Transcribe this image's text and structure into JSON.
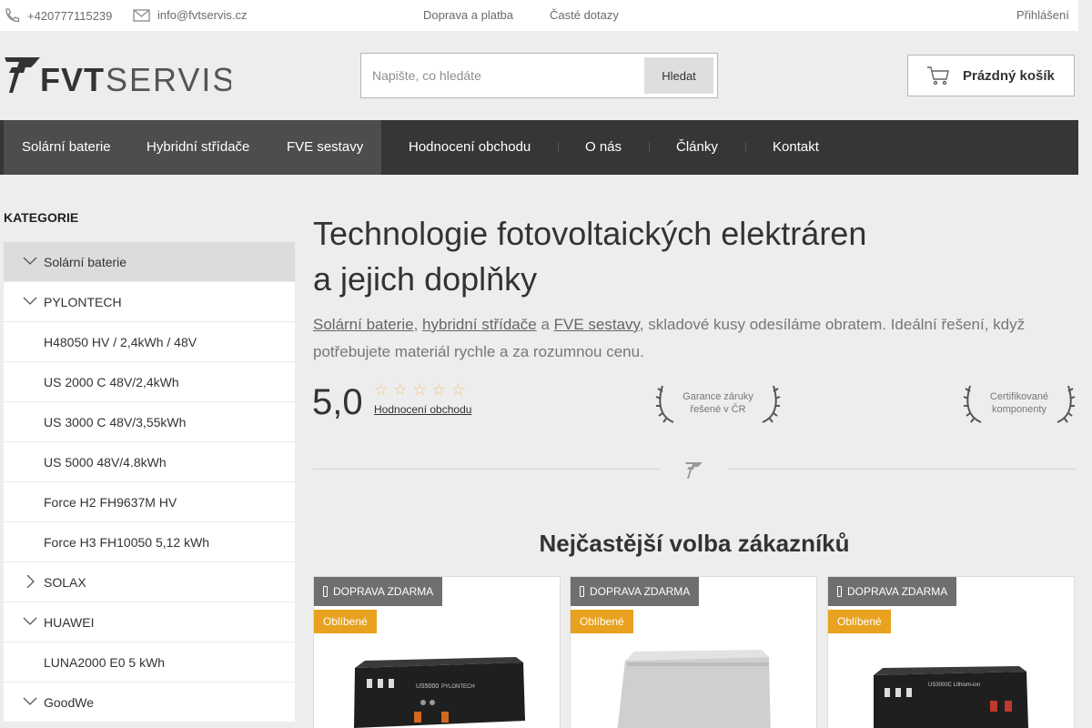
{
  "topbar": {
    "phone": "+420777115239",
    "email": "info@fvtservis.cz",
    "links": [
      "Doprava a platba",
      "Časté dotazy"
    ],
    "login": "Přihlášení"
  },
  "header": {
    "logo_text": "FVTSERVIS",
    "search_placeholder": "Napište, co hledáte",
    "search_button": "Hledat",
    "cart_label": "Prázdný košík"
  },
  "nav": {
    "items": [
      "Solární baterie",
      "Hybridní střídače",
      "FVE sestavy",
      "Hodnocení obchodu",
      "O nás",
      "Články",
      "Kontakt"
    ]
  },
  "sidebar": {
    "title": "KATEGORIE",
    "items": [
      {
        "label": "Solární baterie",
        "chevron": "down",
        "active": true
      },
      {
        "label": "PYLONTECH",
        "chevron": "down"
      },
      {
        "label": "H48050 HV / 2,4kWh / 48V"
      },
      {
        "label": "US 2000 C 48V/2,4kWh"
      },
      {
        "label": "US 3000 C 48V/3,55kWh"
      },
      {
        "label": "US 5000 48V/4.8kWh"
      },
      {
        "label": "Force H2 FH9637M HV"
      },
      {
        "label": "Force H3 FH10050 5,12 kWh"
      },
      {
        "label": "SOLAX",
        "chevron": "right"
      },
      {
        "label": "HUAWEI",
        "chevron": "down"
      },
      {
        "label": "LUNA2000 E0 5 kWh"
      },
      {
        "label": "GoodWe",
        "chevron": "down"
      }
    ]
  },
  "main": {
    "headline_line1": "Technologie fotovoltaických elektráren",
    "headline_line2": "a jejich doplňky",
    "intro": {
      "link1": "Solární baterie",
      "sep1": ", ",
      "link2": "hybridní střídače",
      "sep2": " a ",
      "link3": "FVE sestavy",
      "rest": ", skladové kusy odesíláme obratem. Ideální řešení, když potřebujete materiál rychle a za rozumnou cenu."
    },
    "rating_value": "5,0",
    "rating_stars": 5,
    "rating_link": "Hodnocení obchodu",
    "badges": [
      {
        "line1": "Garance záruky",
        "line2": "řešené v ČR"
      },
      {
        "line1": "Certifikované",
        "line2": "komponenty"
      }
    ],
    "section_title": "Nejčastější volba zákazníků",
    "products": [
      {
        "ship_tag": "DOPRAVA ZDARMA",
        "pop_tag": "Oblíbené",
        "image": "rack-battery-black"
      },
      {
        "ship_tag": "DOPRAVA ZDARMA",
        "pop_tag": "Oblíbené",
        "image": "battery-grey-box"
      },
      {
        "ship_tag": "DOPRAVA ZDARMA",
        "pop_tag": "Oblíbené",
        "image": "rack-battery-black"
      }
    ]
  },
  "colors": {
    "nav_bg": "#363636",
    "nav_highlight": "#4d4d4d",
    "accent_orange": "#e8a21f",
    "page_bg": "#ededed"
  }
}
